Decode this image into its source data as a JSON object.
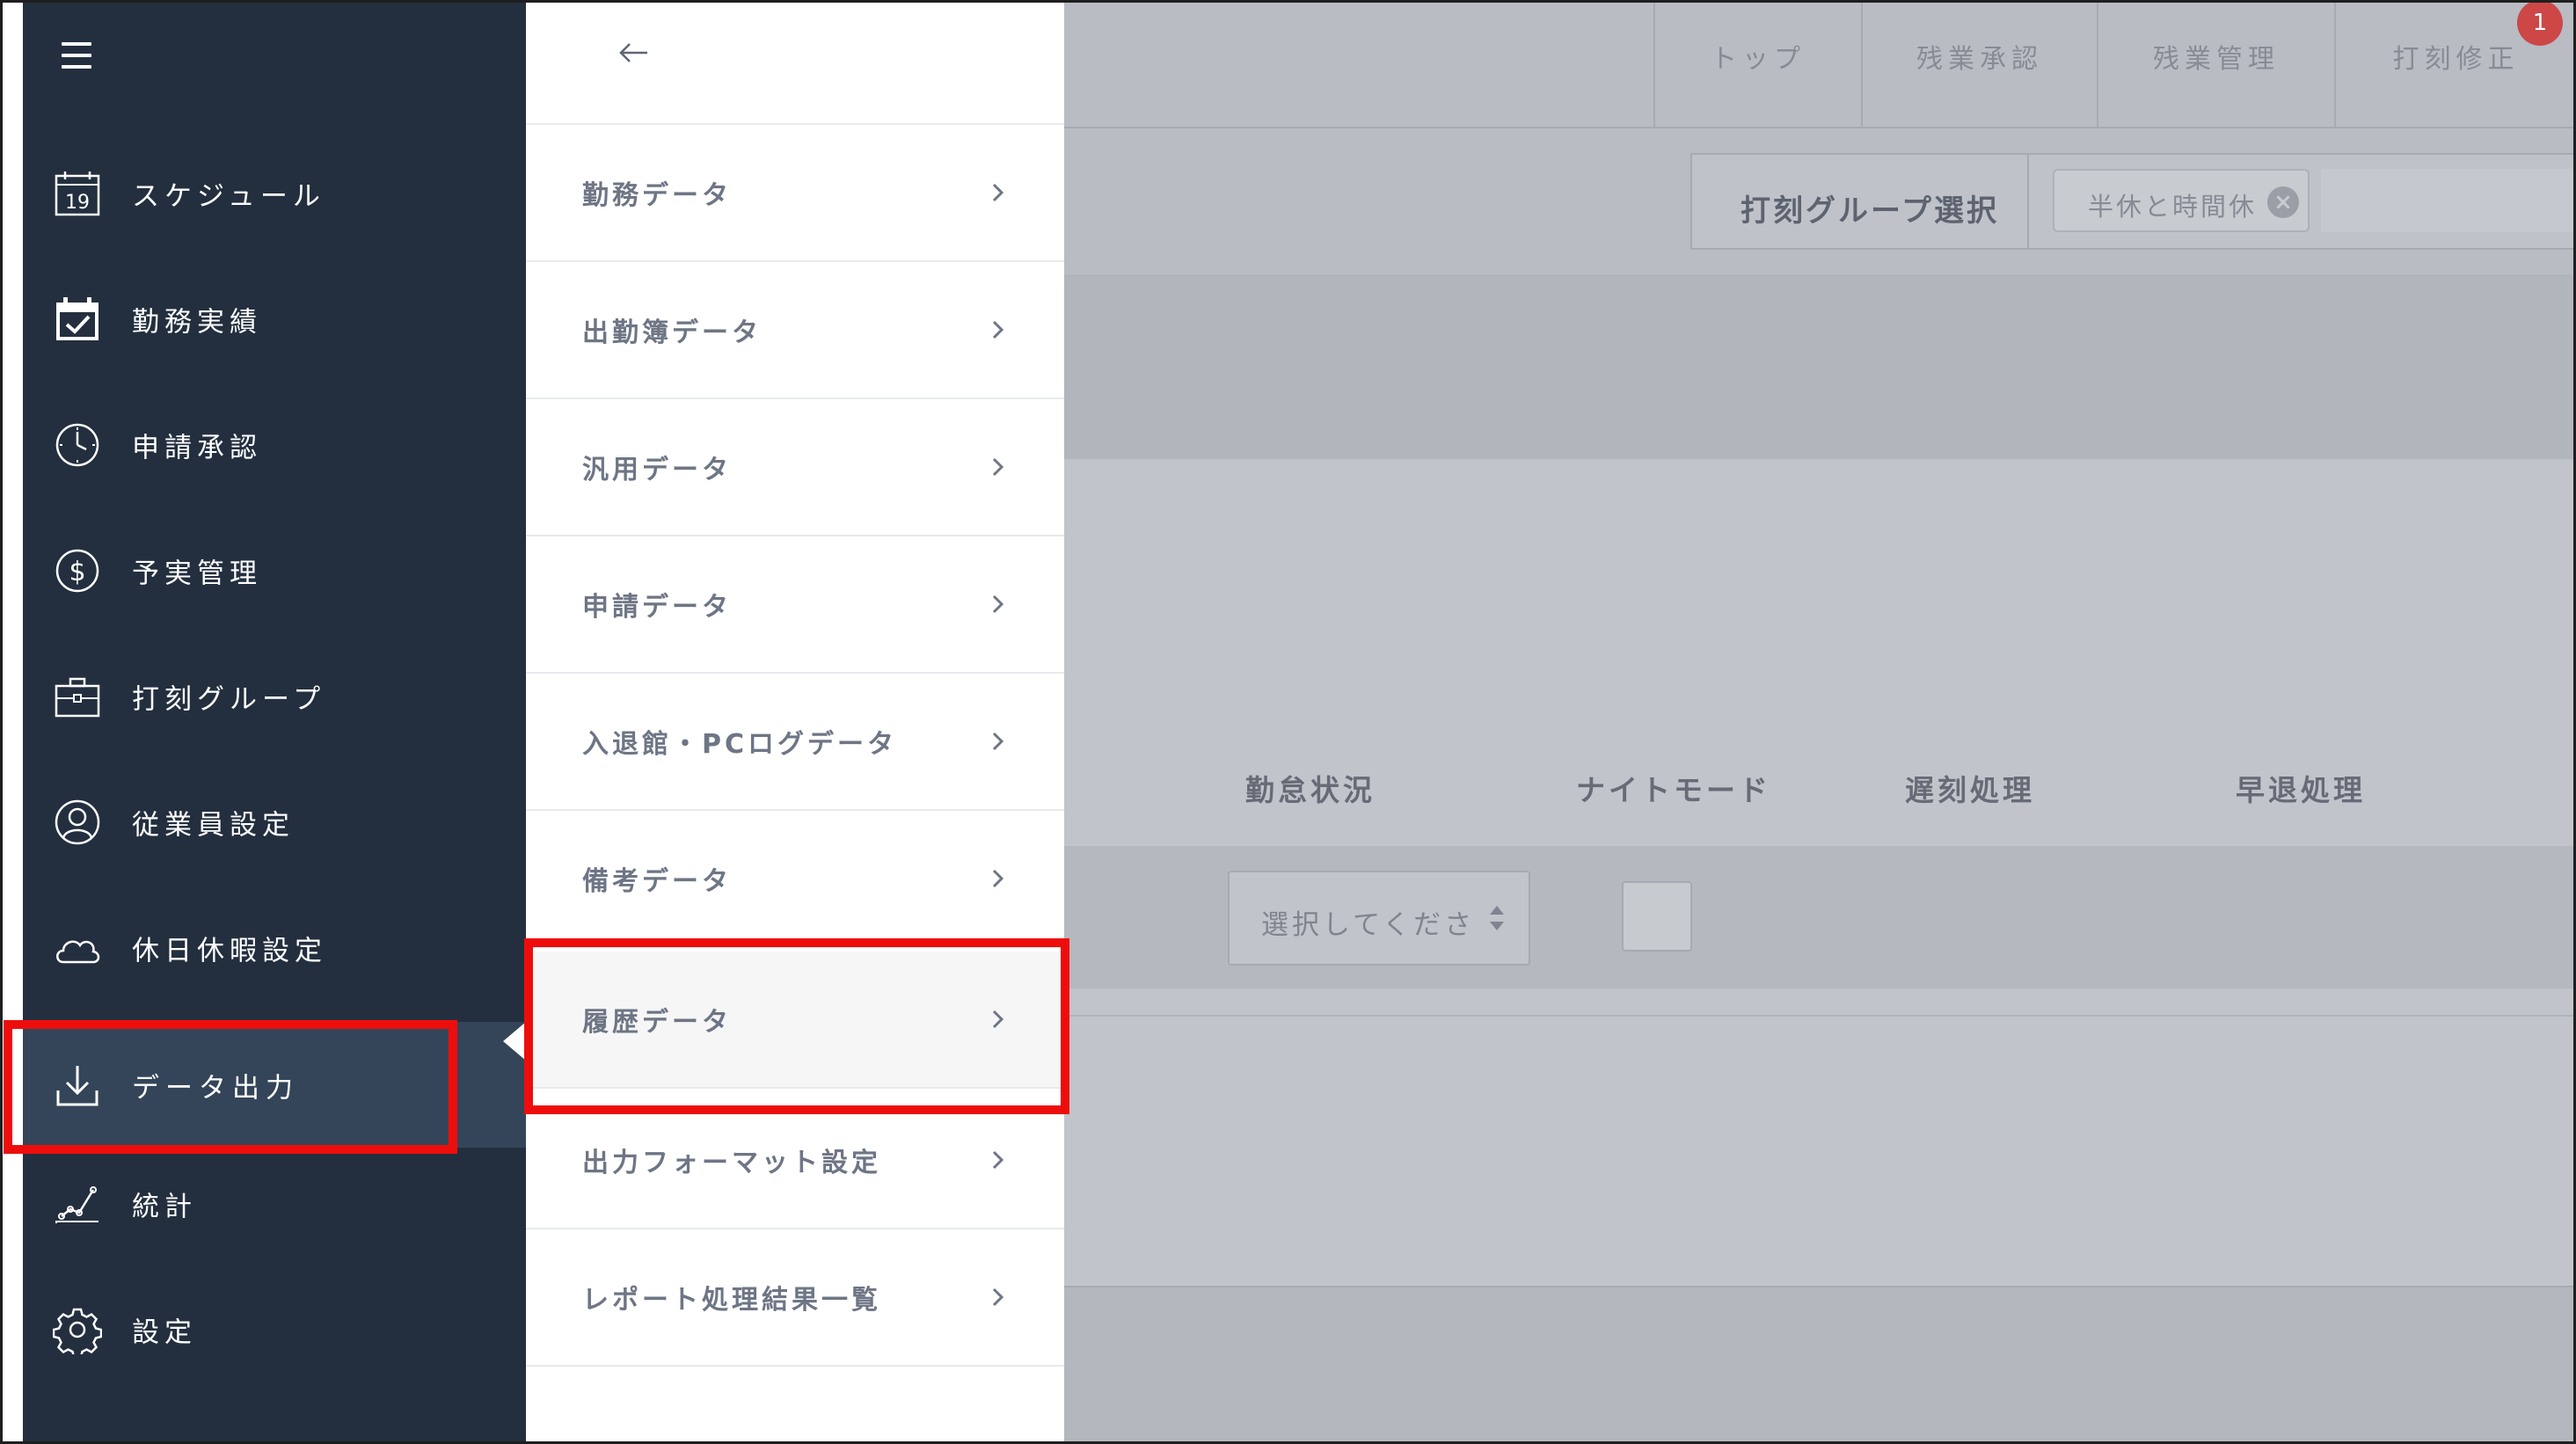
{
  "sidebar": {
    "items": [
      {
        "label": "スケジュール",
        "icon": "calendar-19-icon"
      },
      {
        "label": "勤務実績",
        "icon": "calendar-check-icon"
      },
      {
        "label": "申請承認",
        "icon": "clock-icon"
      },
      {
        "label": "予実管理",
        "icon": "dollar-icon"
      },
      {
        "label": "打刻グループ",
        "icon": "briefcase-icon"
      },
      {
        "label": "従業員設定",
        "icon": "user-icon"
      },
      {
        "label": "休日休暇設定",
        "icon": "cloud-icon"
      },
      {
        "label": "データ出力",
        "icon": "download-icon"
      },
      {
        "label": "統計",
        "icon": "chart-icon"
      },
      {
        "label": "設定",
        "icon": "gear-icon"
      }
    ],
    "active_item": "データ出力"
  },
  "submenu": {
    "items": [
      {
        "label": "勤務データ"
      },
      {
        "label": "出勤簿データ"
      },
      {
        "label": "汎用データ"
      },
      {
        "label": "申請データ"
      },
      {
        "label": "入退館・PCログデータ"
      },
      {
        "label": "備考データ"
      },
      {
        "label": "履歴データ"
      },
      {
        "label": "出力フォーマット設定"
      },
      {
        "label": "レポート処理結果一覧"
      }
    ],
    "highlighted_item": "履歴データ"
  },
  "main": {
    "top_tabs": [
      {
        "label": "トップ"
      },
      {
        "label": "残業承認"
      },
      {
        "label": "残業管理"
      },
      {
        "label": "打刻修正"
      }
    ],
    "notification_count": "1",
    "group_select": {
      "label": "打刻グループ選択",
      "tag": "半休と時間休",
      "tag_remove": "×"
    },
    "columns": [
      {
        "label": "勤怠状況"
      },
      {
        "label": "ナイトモード"
      },
      {
        "label": "遅刻処理"
      },
      {
        "label": "早退処理"
      }
    ],
    "row": {
      "select_placeholder": "選択してくださ"
    }
  },
  "colors": {
    "sidebar_bg": "#232f3f",
    "sidebar_active_bg": "#344559",
    "overlay_bg": "#c1c4ca",
    "callout": "#ee0d0d",
    "badge": "#cd4747"
  }
}
